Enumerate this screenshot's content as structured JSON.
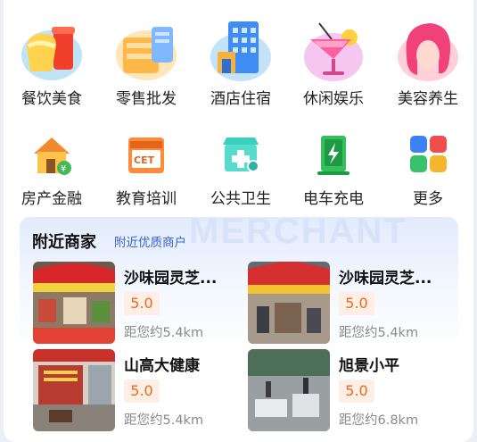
{
  "categories_row1": [
    {
      "label": "餐饮美食",
      "icon": "food-drink-icon"
    },
    {
      "label": "零售批发",
      "icon": "retail-box-icon"
    },
    {
      "label": "酒店住宿",
      "icon": "hotel-building-icon"
    },
    {
      "label": "休闲娱乐",
      "icon": "cocktail-icon"
    },
    {
      "label": "美容养生",
      "icon": "beauty-face-icon"
    }
  ],
  "categories_row2": [
    {
      "label": "房产金融",
      "icon": "house-icon"
    },
    {
      "label": "教育培训",
      "icon": "education-cet-icon"
    },
    {
      "label": "公共卫生",
      "icon": "public-health-icon"
    },
    {
      "label": "电车充电",
      "icon": "ev-charging-icon"
    },
    {
      "label": "更多",
      "icon": "more-grid-icon"
    }
  ],
  "nearby": {
    "title": "附近商家",
    "subtitle": "附近优质商户",
    "watermark": "MERCHANT",
    "merchants": [
      {
        "name": "沙味园灵芝...",
        "rating": "5.0",
        "distance": "距您约5.4km"
      },
      {
        "name": "沙味园灵芝...",
        "rating": "5.0",
        "distance": "距您约5.4km"
      },
      {
        "name": "山高大健康",
        "rating": "5.0",
        "distance": "距您约5.4km"
      },
      {
        "name": "旭景小平",
        "rating": "5.0",
        "distance": "距您约6.8km"
      }
    ]
  },
  "colors": {
    "accent_blue": "#3a62d6",
    "rating_orange": "#ec6a1e",
    "rating_bg": "#fdeee6"
  }
}
